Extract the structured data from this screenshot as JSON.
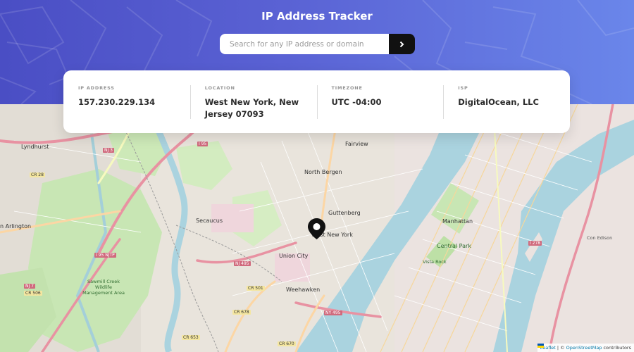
{
  "header": {
    "title": "IP Address Tracker",
    "search_placeholder": "Search for any IP address or domain",
    "search_value": ""
  },
  "info": {
    "ip_label": "IP ADDRESS",
    "ip_value": "157.230.229.134",
    "location_label": "LOCATION",
    "location_value": "West New York, New Jersey 07093",
    "timezone_label": "TIMEZONE",
    "timezone_value": "UTC -04:00",
    "isp_label": "ISP",
    "isp_value": "DigitalOcean, LLC"
  },
  "map": {
    "labels": {
      "lyndhurst": "Lyndhurst",
      "north_bergen": "North Bergen",
      "fairview": "Fairview",
      "secaucus": "Secaucus",
      "guttenberg": "Guttenberg",
      "west_new_york": "West New York",
      "union_city": "Union City",
      "weehawken": "Weehawken",
      "manhattan": "Manhattan",
      "central_park": "Central Park",
      "kearny": "n Arlington",
      "con_edison": "Con Edison",
      "vista_rock": "Vista Rock",
      "sawmill": "Sawmill Creek Wildlife Management Area",
      "nj3": "NJ 3",
      "cr28": "CR 28",
      "i95": "I 95",
      "i95_njtp": "I 95 NJTP",
      "nj495": "NJ 495",
      "cr501": "CR 501",
      "cr678": "CR 678",
      "cr670": "CR 670",
      "cr653": "CR 653",
      "ny495": "NY 495",
      "i278": "I 278",
      "nj7": "NJ 7",
      "cr506": "CR 506"
    },
    "attribution": {
      "leaflet": "Leaflet",
      "separator": "| ©",
      "osm": "OpenStreetMap",
      "contributors": "contributors"
    }
  },
  "colors": {
    "header_start": "#4a4ec4",
    "header_end": "#6a86ea",
    "button": "#111111",
    "marker": "#111111",
    "water": "#aad3df",
    "park": "#c8e6b4"
  }
}
